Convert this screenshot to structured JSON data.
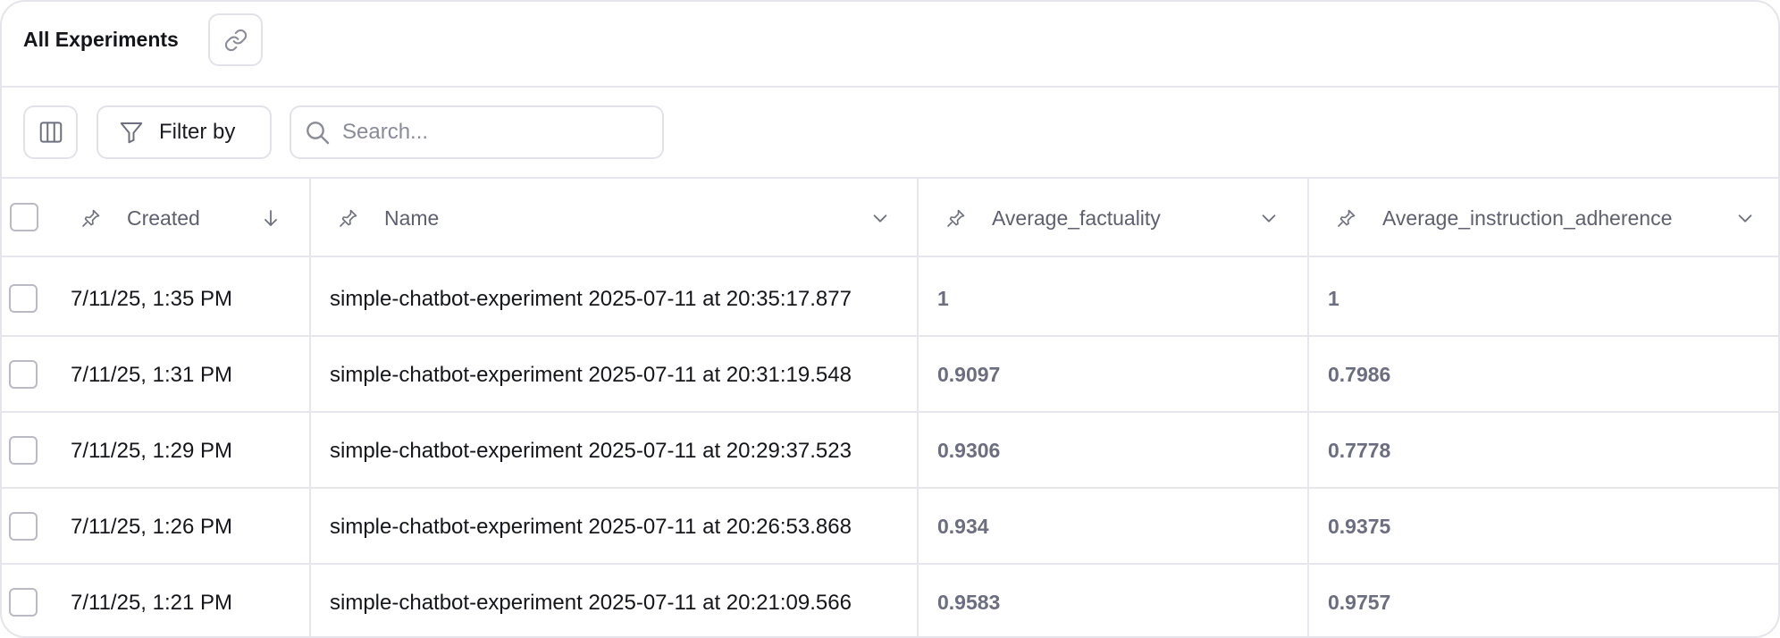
{
  "header": {
    "title": "All Experiments"
  },
  "toolbar": {
    "filter_label": "Filter by",
    "search_placeholder": "Search..."
  },
  "columns": [
    {
      "label": "Created",
      "icon": "arrow-down-icon"
    },
    {
      "label": "Name",
      "icon": "chevron-down-icon"
    },
    {
      "label": "Average_factuality",
      "icon": "chevron-down-icon"
    },
    {
      "label": "Average_instruction_adherence",
      "icon": "chevron-down-icon"
    }
  ],
  "rows": [
    {
      "created": "7/11/25, 1:35 PM",
      "name": "simple-chatbot-experiment 2025-07-11 at 20:35:17.877",
      "factuality": "1",
      "adherence": "1"
    },
    {
      "created": "7/11/25, 1:31 PM",
      "name": "simple-chatbot-experiment 2025-07-11 at 20:31:19.548",
      "factuality": "0.9097",
      "adherence": "0.7986"
    },
    {
      "created": "7/11/25, 1:29 PM",
      "name": "simple-chatbot-experiment 2025-07-11 at 20:29:37.523",
      "factuality": "0.9306",
      "adherence": "0.7778"
    },
    {
      "created": "7/11/25, 1:26 PM",
      "name": "simple-chatbot-experiment 2025-07-11 at 20:26:53.868",
      "factuality": "0.934",
      "adherence": "0.9375"
    },
    {
      "created": "7/11/25, 1:21 PM",
      "name": "simple-chatbot-experiment 2025-07-11 at 20:21:09.566",
      "factuality": "0.9583",
      "adherence": "0.9757"
    }
  ],
  "colors": {
    "border": "#e6e6ec",
    "header_text": "#5e6070",
    "score_text": "#6b6d80"
  }
}
